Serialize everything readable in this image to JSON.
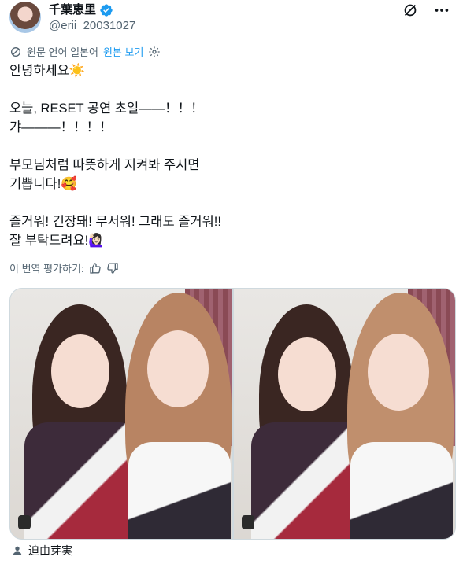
{
  "author": {
    "display_name": "千葉恵里",
    "handle": "@erii_20031027",
    "verified_icon": "verified-badge-icon"
  },
  "header_actions": {
    "grok_icon": "slash-circle-icon",
    "more_icon": "more-horizontal-icon"
  },
  "translation": {
    "source_label": "원문 언어 일본어",
    "show_original": "원본 보기",
    "settings_icon": "gear-icon"
  },
  "tweet": {
    "text": "안녕하세요☀️\n\n오늘, RESET 공연 초일——！！！\n갸———！！！！\n\n부모님처럼 따뜻하게 지켜봐 주시면\n기쁩니다!🥰\n\n즐거워! 긴장돼! 무서워! 그래도 즐거워!!\n잘 부탁드려요!🙋🏻‍♀️"
  },
  "rating": {
    "label": "이 번역 평가하기:",
    "thumbs_up_icon": "thumbs-up-icon",
    "thumbs_down_icon": "thumbs-down-icon"
  },
  "media": {
    "photos": [
      {
        "badge": "gif-badge"
      },
      {
        "badge": "gif-badge"
      }
    ]
  },
  "tagged": {
    "icon": "user-icon",
    "name": "迫由芽実"
  },
  "colors": {
    "accent": "#1d9bf0",
    "secondary_text": "#536471",
    "border": "#cfd9de"
  }
}
